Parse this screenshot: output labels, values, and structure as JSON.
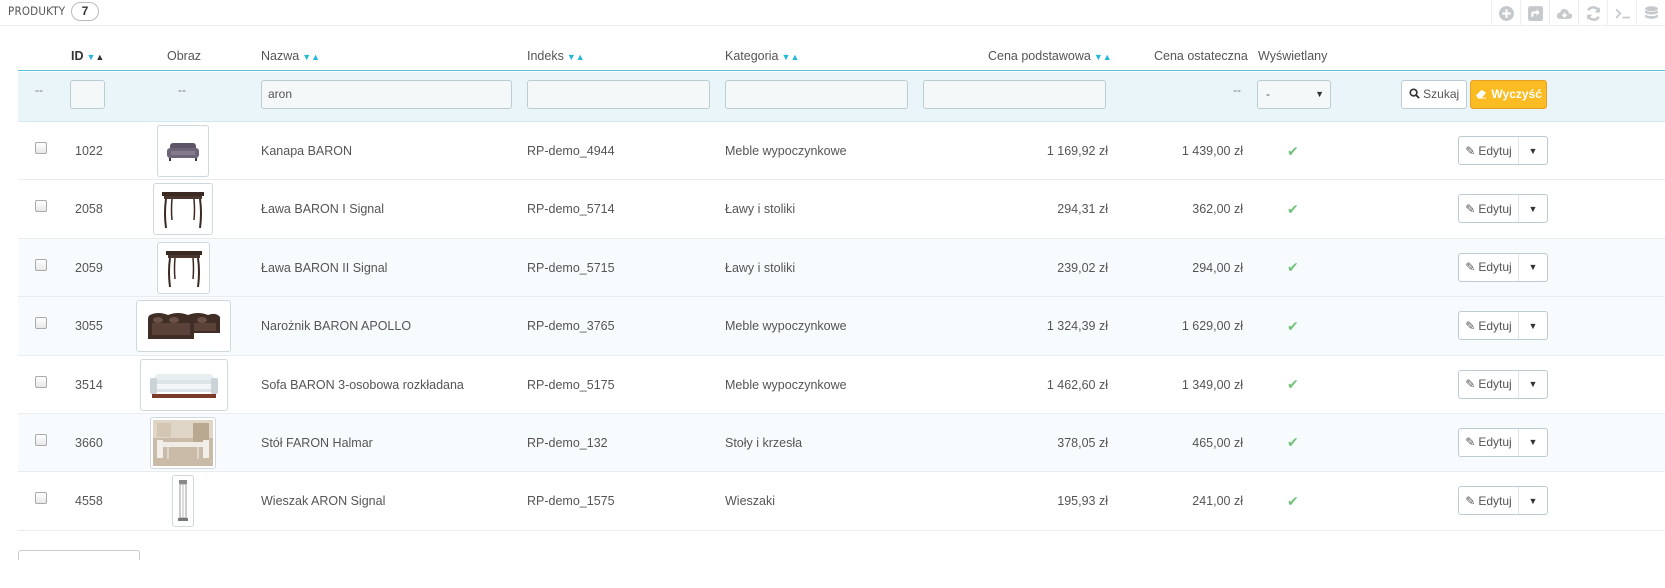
{
  "heading": {
    "title": "PRODUKTY",
    "count": "7"
  },
  "toolbar": [
    "add-icon",
    "export-icon",
    "cloud-icon",
    "refresh-icon",
    "sql-icon",
    "database-icon"
  ],
  "columns": {
    "id": "ID",
    "image": "Obraz",
    "name": "Nazwa",
    "reference": "Indeks",
    "category": "Kategoria",
    "base_price": "Cena podstawowa",
    "final_price": "Cena ostateczna",
    "active": "Wyświetlany"
  },
  "filters": {
    "id_dash": "--",
    "image_dash": "--",
    "name_value": "aron",
    "final_price_dash": "--",
    "active_select": "-",
    "search_label": "Szukaj",
    "clear_label": "Wyczyść"
  },
  "rows": [
    {
      "id": "1022",
      "name": "Kanapa BARON",
      "reference": "RP-demo_4944",
      "category": "Meble wypoczynkowe",
      "base_price": "1 169,92 zł",
      "final_price": "1 439,00 zł",
      "active": true,
      "edit_label": "Edytuj",
      "image": "sofa-small"
    },
    {
      "id": "2058",
      "name": "Ława BARON I Signal",
      "reference": "RP-demo_5714",
      "category": "Ławy i stoliki",
      "base_price": "294,31 zł",
      "final_price": "362,00 zł",
      "active": true,
      "edit_label": "Edytuj",
      "image": "table"
    },
    {
      "id": "2059",
      "name": "Ława BARON II Signal",
      "reference": "RP-demo_5715",
      "category": "Ławy i stoliki",
      "base_price": "239,02 zł",
      "final_price": "294,00 zł",
      "active": true,
      "edit_label": "Edytuj",
      "image": "table-square"
    },
    {
      "id": "3055",
      "name": "Narożnik BARON APOLLO",
      "reference": "RP-demo_3765",
      "category": "Meble wypoczynkowe",
      "base_price": "1 324,39 zł",
      "final_price": "1 629,00 zł",
      "active": true,
      "edit_label": "Edytuj",
      "image": "corner-sofa"
    },
    {
      "id": "3514",
      "name": "Sofa BARON 3-osobowa rozkładana",
      "reference": "RP-demo_5175",
      "category": "Meble wypoczynkowe",
      "base_price": "1 462,60 zł",
      "final_price": "1 349,00 zł",
      "active": true,
      "edit_label": "Edytuj",
      "image": "sofa-white"
    },
    {
      "id": "3660",
      "name": "Stół FARON Halmar",
      "reference": "RP-demo_132",
      "category": "Stoły i krzesła",
      "base_price": "378,05 zł",
      "final_price": "465,00 zł",
      "active": true,
      "edit_label": "Edytuj",
      "image": "dining-room"
    },
    {
      "id": "4558",
      "name": "Wieszak ARON Signal",
      "reference": "RP-demo_1575",
      "category": "Wieszaki",
      "base_price": "195,93 zł",
      "final_price": "241,00 zł",
      "active": true,
      "edit_label": "Edytuj",
      "image": "coat-stand"
    }
  ],
  "colors": {
    "accent": "#25b9d7",
    "filter_bg": "#eaf5fa",
    "warning": "#fbbb22",
    "success": "#72c279"
  }
}
